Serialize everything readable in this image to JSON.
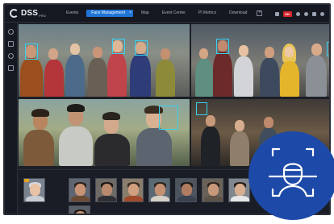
{
  "app": {
    "logo_text": "DSS",
    "logo_sup": "PRO"
  },
  "nav": {
    "tabs": [
      {
        "label": "Events"
      },
      {
        "label": "Face Management",
        "active": true
      },
      {
        "label": "Map"
      },
      {
        "label": "Event Center"
      },
      {
        "label": "PI Metrics"
      },
      {
        "label": "Download"
      }
    ]
  },
  "toolbar": {
    "alarm_badge": "99+"
  },
  "colors": {
    "accent": "#1f74d6",
    "detection_box": "#37d2f0",
    "alarm": "#d8242a",
    "badge_bg": "#1d4aa8"
  },
  "icons": {
    "badge": "face-recognition-icon",
    "sidebar": [
      "search-icon",
      "list-icon",
      "person-icon",
      "settings-icon"
    ]
  },
  "thumbnail_count": 10
}
